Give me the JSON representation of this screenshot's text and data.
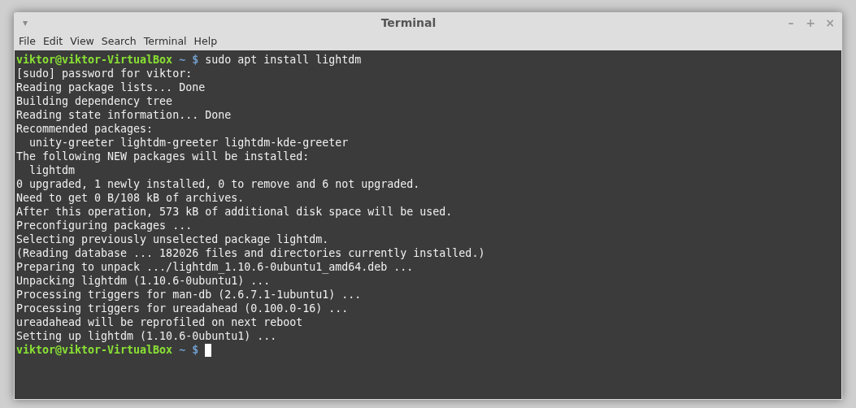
{
  "window": {
    "title": "Terminal",
    "menu_symbol": "▾",
    "controls": [
      "–",
      "+",
      "×"
    ]
  },
  "menu": [
    "File",
    "Edit",
    "View",
    "Search",
    "Terminal",
    "Help"
  ],
  "lines": [
    {
      "kind": "prompt",
      "user_host": "viktor@viktor-VirtualBox",
      "path": "~",
      "symbol": "$",
      "command": "sudo apt install lightdm",
      "cursor": false
    },
    {
      "kind": "output",
      "text": "[sudo] password for viktor:"
    },
    {
      "kind": "output",
      "text": "Reading package lists... Done"
    },
    {
      "kind": "output",
      "text": "Building dependency tree"
    },
    {
      "kind": "output",
      "text": "Reading state information... Done"
    },
    {
      "kind": "output",
      "text": "Recommended packages:"
    },
    {
      "kind": "output",
      "text": "  unity-greeter lightdm-greeter lightdm-kde-greeter"
    },
    {
      "kind": "output",
      "text": "The following NEW packages will be installed:"
    },
    {
      "kind": "output",
      "text": "  lightdm"
    },
    {
      "kind": "output",
      "text": "0 upgraded, 1 newly installed, 0 to remove and 6 not upgraded."
    },
    {
      "kind": "output",
      "text": "Need to get 0 B/108 kB of archives."
    },
    {
      "kind": "output",
      "text": "After this operation, 573 kB of additional disk space will be used."
    },
    {
      "kind": "output",
      "text": "Preconfiguring packages ..."
    },
    {
      "kind": "output",
      "text": "Selecting previously unselected package lightdm."
    },
    {
      "kind": "output",
      "text": "(Reading database ... 182026 files and directories currently installed.)"
    },
    {
      "kind": "output",
      "text": "Preparing to unpack .../lightdm_1.10.6-0ubuntu1_amd64.deb ..."
    },
    {
      "kind": "output",
      "text": "Unpacking lightdm (1.10.6-0ubuntu1) ..."
    },
    {
      "kind": "output",
      "text": "Processing triggers for man-db (2.6.7.1-1ubuntu1) ..."
    },
    {
      "kind": "output",
      "text": "Processing triggers for ureadahead (0.100.0-16) ..."
    },
    {
      "kind": "output",
      "text": "ureadahead will be reprofiled on next reboot"
    },
    {
      "kind": "output",
      "text": "Setting up lightdm (1.10.6-0ubuntu1) ..."
    },
    {
      "kind": "prompt",
      "user_host": "viktor@viktor-VirtualBox",
      "path": "~",
      "symbol": "$",
      "cursor": true
    }
  ]
}
